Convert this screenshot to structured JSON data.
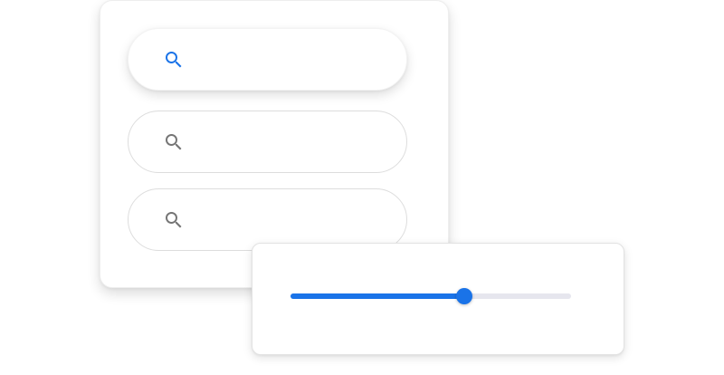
{
  "search_bars": [
    {
      "state": "elevated",
      "icon": "search-icon",
      "icon_color": "#1a73e8"
    },
    {
      "state": "outlined",
      "icon": "search-icon",
      "icon_color": "#757575"
    },
    {
      "state": "outlined",
      "icon": "search-icon",
      "icon_color": "#757575"
    }
  ],
  "slider": {
    "value_fraction": 0.62,
    "active_color": "#1a73e8",
    "inactive_color": "#e6e6ee"
  }
}
